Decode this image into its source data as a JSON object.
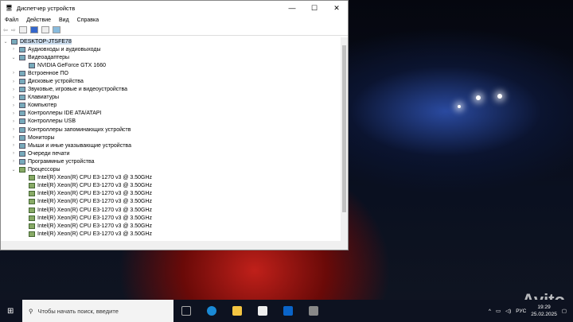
{
  "window": {
    "title": "Диспетчер устройств",
    "minimize": "—",
    "maximize": "☐",
    "close": "✕"
  },
  "menu": [
    "Файл",
    "Действие",
    "Вид",
    "Справка"
  ],
  "tree": {
    "root": "DESKTOP-JTSFE78",
    "items": [
      {
        "label": "Аудиовходы и аудиовыходы",
        "expanded": false
      },
      {
        "label": "Видеоадаптеры",
        "expanded": true,
        "children": [
          "NVIDIA GeForce GTX 1660"
        ]
      },
      {
        "label": "Встроенное ПО",
        "expanded": false
      },
      {
        "label": "Дисковые устройства",
        "expanded": false
      },
      {
        "label": "Звуковые, игровые и видеоустройства",
        "expanded": false
      },
      {
        "label": "Клавиатуры",
        "expanded": false
      },
      {
        "label": "Компьютер",
        "expanded": false
      },
      {
        "label": "Контроллеры IDE ATA/ATAPI",
        "expanded": false
      },
      {
        "label": "Контроллеры USB",
        "expanded": false
      },
      {
        "label": "Контроллеры запоминающих устройств",
        "expanded": false
      },
      {
        "label": "Мониторы",
        "expanded": false
      },
      {
        "label": "Мыши и иные указывающие устройства",
        "expanded": false
      },
      {
        "label": "Очереди печати",
        "expanded": false
      },
      {
        "label": "Программные устройства",
        "expanded": false
      },
      {
        "label": "Процессоры",
        "expanded": true,
        "children": [
          "Intel(R) Xeon(R) CPU E3-1270 v3 @ 3.50GHz",
          "Intel(R) Xeon(R) CPU E3-1270 v3 @ 3.50GHz",
          "Intel(R) Xeon(R) CPU E3-1270 v3 @ 3.50GHz",
          "Intel(R) Xeon(R) CPU E3-1270 v3 @ 3.50GHz",
          "Intel(R) Xeon(R) CPU E3-1270 v3 @ 3.50GHz",
          "Intel(R) Xeon(R) CPU E3-1270 v3 @ 3.50GHz",
          "Intel(R) Xeon(R) CPU E3-1270 v3 @ 3.50GHz",
          "Intel(R) Xeon(R) CPU E3-1270 v3 @ 3.50GHz"
        ]
      }
    ]
  },
  "taskbar": {
    "search_placeholder": "Чтобы начать поиск, введите",
    "lang": "РУС",
    "time": "19:29",
    "date": "25.02.2025"
  },
  "watermark": "Avito"
}
